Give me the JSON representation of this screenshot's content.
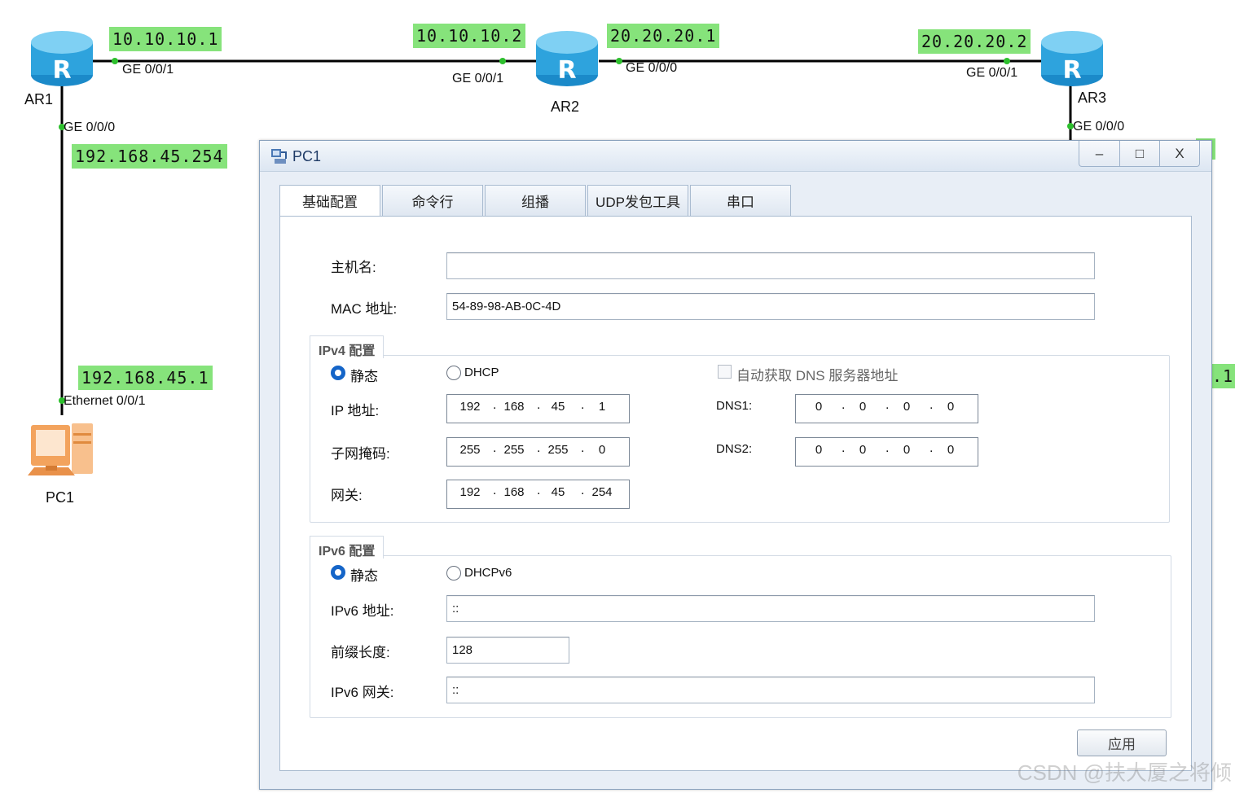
{
  "topology": {
    "devices": [
      {
        "name": "AR1"
      },
      {
        "name": "AR2"
      },
      {
        "name": "AR3"
      },
      {
        "name": "PC1"
      }
    ],
    "ip_labels": [
      "10.10.10.1",
      "10.10.10.2",
      "20.20.20.1",
      "20.20.20.2",
      "192.168.45.254",
      "192.168.45.1"
    ],
    "port_labels": [
      "GE 0/0/1",
      "GE 0/0/1",
      "GE 0/0/0",
      "GE 0/0/1",
      "GE 0/0/0",
      "GE 0/0/0",
      "Ethernet 0/0/1"
    ],
    "partial_label": ".1"
  },
  "window": {
    "title": "PC1",
    "controls": {
      "minimize": "–",
      "maximize": "□",
      "close": "X"
    },
    "tabs": [
      "基础配置",
      "命令行",
      "组播",
      "UDP发包工具",
      "串口"
    ],
    "form": {
      "hostname_label": "主机名:",
      "hostname_value": "",
      "mac_label": "MAC 地址:",
      "mac_value": "54-89-98-AB-0C-4D",
      "ipv4": {
        "title": "IPv4 配置",
        "static_label": "静态",
        "dhcp_label": "DHCP",
        "auto_dns_label": "自动获取 DNS 服务器地址",
        "ip_label": "IP 地址:",
        "ip": [
          "192",
          "168",
          "45",
          "1"
        ],
        "mask_label": "子网掩码:",
        "mask": [
          "255",
          "255",
          "255",
          "0"
        ],
        "gw_label": "网关:",
        "gw": [
          "192",
          "168",
          "45",
          "254"
        ],
        "dns1_label": "DNS1:",
        "dns1": [
          "0",
          "0",
          "0",
          "0"
        ],
        "dns2_label": "DNS2:",
        "dns2": [
          "0",
          "0",
          "0",
          "0"
        ]
      },
      "ipv6": {
        "title": "IPv6 配置",
        "static_label": "静态",
        "dhcp_label": "DHCPv6",
        "addr_label": "IPv6 地址:",
        "addr_value": "::",
        "prefix_label": "前缀长度:",
        "prefix_value": "128",
        "gw_label": "IPv6 网关:",
        "gw_value": "::"
      },
      "apply_label": "应用"
    }
  },
  "watermark": "CSDN @扶大厦之将倾"
}
